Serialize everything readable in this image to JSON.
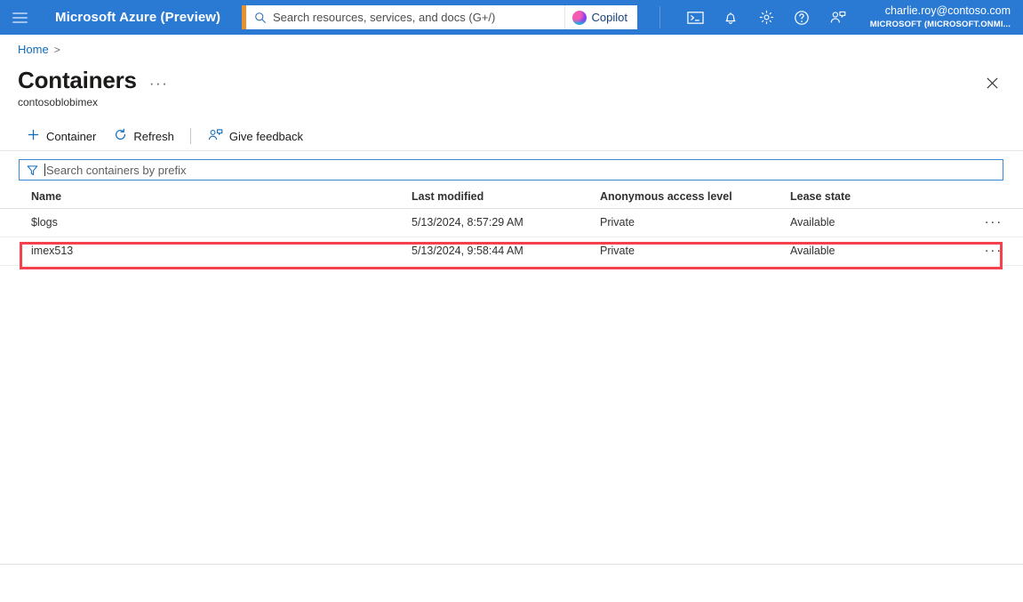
{
  "header": {
    "menu_icon": "hamburger-menu-icon",
    "brand": "Microsoft Azure (Preview)",
    "search": {
      "placeholder": "Search resources, services, and docs (G+/)",
      "value": "",
      "icon": "search-icon",
      "accent_color": "#e8912d"
    },
    "copilot": {
      "label": "Copilot",
      "icon": "copilot-icon"
    },
    "icons": [
      {
        "name": "cloud-shell-icon",
        "title": "Cloud Shell"
      },
      {
        "name": "notifications-bell-icon",
        "title": "Notifications"
      },
      {
        "name": "settings-gear-icon",
        "title": "Settings"
      },
      {
        "name": "help-question-icon",
        "title": "Help"
      },
      {
        "name": "feedback-person-icon",
        "title": "Feedback"
      }
    ],
    "account": {
      "email": "charlie.roy@contoso.com",
      "org": "MICROSOFT (MICROSOFT.ONMI..."
    },
    "background_color": "#2a7ad4"
  },
  "breadcrumb": {
    "items": [
      "Home"
    ],
    "separator": ">"
  },
  "page": {
    "title": "Containers",
    "title_more": "···",
    "subtitle": "contosoblobimex",
    "close_icon": "close-icon"
  },
  "toolbar": {
    "items": [
      {
        "label": "Container",
        "icon": "plus-icon"
      },
      {
        "label": "Refresh",
        "icon": "refresh-icon"
      },
      {
        "label": "Give feedback",
        "icon": "feedback-person-icon"
      }
    ]
  },
  "filter": {
    "placeholder": "Search containers by prefix",
    "value": "",
    "icon": "filter-funnel-icon"
  },
  "table": {
    "columns": [
      "Name",
      "Last modified",
      "Anonymous access level",
      "Lease state"
    ],
    "row_menu_icon": "more-actions-ellipsis-icon",
    "row_menu_label": "···",
    "rows": [
      {
        "name": "$logs",
        "last_modified": "5/13/2024, 8:57:29 AM",
        "anonymous_access_level": "Private",
        "lease_state": "Available",
        "highlighted": false
      },
      {
        "name": "imex513",
        "last_modified": "5/13/2024, 9:58:44 AM",
        "anonymous_access_level": "Private",
        "lease_state": "Available",
        "highlighted": true
      }
    ]
  },
  "annotation": {
    "highlight_color": "#f4414d",
    "target_row": "imex513"
  }
}
